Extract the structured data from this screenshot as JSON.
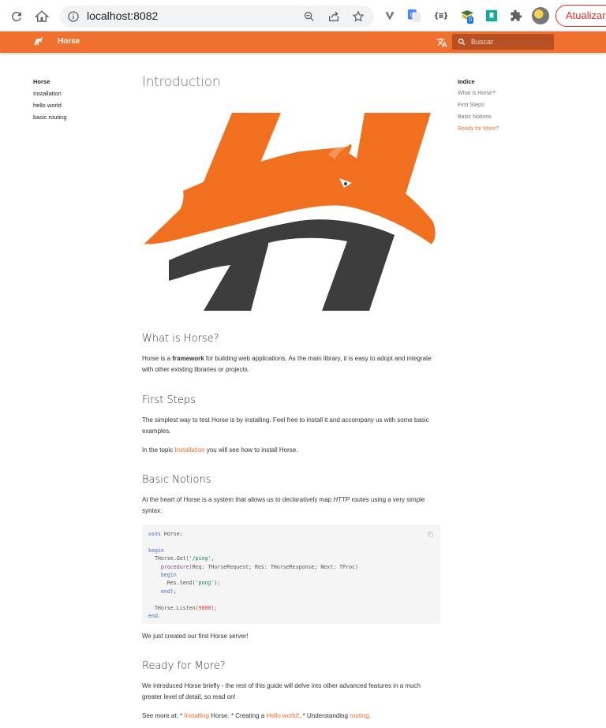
{
  "browser": {
    "url": "localhost:8082",
    "update_label": "Atualizar",
    "ext_badge": "0",
    "ext_json_label": "{≡}"
  },
  "appbar": {
    "brand": "Horse",
    "search_placeholder": "Buscar",
    "accent_color": "#f07030"
  },
  "leftnav": {
    "items": [
      {
        "label": "Horse",
        "active": true
      },
      {
        "label": "Installation"
      },
      {
        "label": "hello world"
      },
      {
        "label": "basic routing"
      }
    ]
  },
  "toc": {
    "title": "Indice",
    "items": [
      {
        "label": "What is Horse?"
      },
      {
        "label": "First Steps"
      },
      {
        "label": "Basic Notions"
      },
      {
        "label": "Ready for More?",
        "active": true
      }
    ]
  },
  "content": {
    "title": "Introduction",
    "what": {
      "heading": "What is Horse?",
      "text_before": "Horse is a ",
      "bold": "framework",
      "text_after": " for building web applications. As the main library, it is easy to adopt and integrate with other existing libraries or projects."
    },
    "first": {
      "heading": "First Steps",
      "p1": "The simplest way to test Horse is by installing. Feel free to install it and accompany us with some basic examples.",
      "p2_before": "In the topic ",
      "p2_link": "Installation",
      "p2_after": " you will see how to install Horse."
    },
    "basic": {
      "heading": "Basic Notions",
      "p_before": "At the heart of Horse is a system that allows us to declaratively map ",
      "p_italic": "HTTP",
      "p_after": " routes using a very simple syntax:",
      "after_code": "We just created our first Horse server!"
    },
    "code": {
      "uses_kw": "uses",
      "uses_rest": " Horse;",
      "begin": "begin",
      "get_call": "  THorse.Get(",
      "get_path": "'/ping'",
      "get_comma": ",",
      "procedure_kw": "    procedure",
      "procedure_rest": "(Req: THorseRequest; Res: THorseResponse; Next: TProc)",
      "inner_begin": "    begin",
      "send_call": "      Res.Send(",
      "send_arg": "'pong'",
      "send_end": ");",
      "inner_end": "    end",
      "inner_end_rest": ");",
      "listen_call": "  THorse.Listen(",
      "listen_port": "9000",
      "listen_end": ");",
      "end": "end."
    },
    "ready": {
      "heading": "Ready for More?",
      "p1": "We introduced Horse briefly - the rest of this guide will delve into other advanced features in a much greater level of detail, so read on!",
      "see_more": "See more at: * ",
      "link1": "Installing",
      "mid1": " Horse. * Creating a ",
      "link2": "Hello world!",
      "mid2": ". * Understanding ",
      "link3": "routing",
      "end": "."
    }
  },
  "icons": [
    "back-icon",
    "forward-icon",
    "reload-icon",
    "home-icon",
    "info-icon",
    "zoom-icon",
    "share-icon",
    "star-icon",
    "horse-logo-icon",
    "translate-icon",
    "search-icon",
    "copy-icon",
    "puzzle-icon"
  ]
}
